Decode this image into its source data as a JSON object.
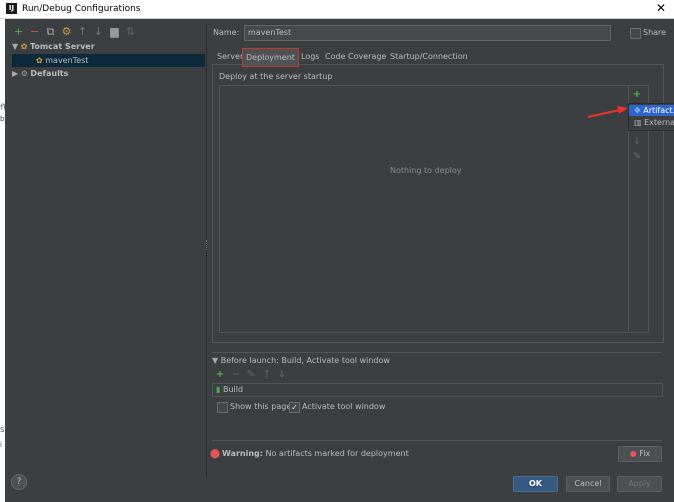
{
  "window": {
    "title": "Run/Debug Configurations",
    "app_icon_text": "IJ",
    "close_glyph": "✕"
  },
  "left_edge_chars": [
    "作",
    "b",
    "S",
    "i"
  ],
  "left_toolbar": [
    {
      "name": "add-icon",
      "glyph": "+",
      "color": "#4caf50"
    },
    {
      "name": "remove-icon",
      "glyph": "−",
      "color": "#e05050"
    },
    {
      "name": "copy-icon",
      "glyph": "⧉",
      "color": "#aaaaaa"
    },
    {
      "name": "wrench-icon",
      "glyph": "⚙",
      "color": "#cc9944"
    },
    {
      "name": "move-up-icon",
      "glyph": "↑",
      "color": "#777777"
    },
    {
      "name": "move-down-icon",
      "glyph": "↓",
      "color": "#777777"
    },
    {
      "name": "folder-icon",
      "glyph": "▆",
      "color": "#999999"
    },
    {
      "name": "sort-icon",
      "glyph": "⇅",
      "color": "#666666"
    }
  ],
  "tree": {
    "tomcat_label": "Tomcat Server",
    "maven_label": "mavenTest",
    "defaults_label": "Defaults"
  },
  "name_field": {
    "label": "Name:",
    "value": "mavenTest"
  },
  "share": {
    "label": "Share",
    "checked": false
  },
  "tabs": [
    {
      "label": "Server",
      "active": false
    },
    {
      "label": "Deployment",
      "active": true
    },
    {
      "label": "Logs",
      "active": false
    },
    {
      "label": "Code Coverage",
      "active": false
    },
    {
      "label": "Startup/Connection",
      "active": false
    }
  ],
  "deploy": {
    "section_label": "Deploy at the server startup",
    "empty_text": "Nothing to deploy"
  },
  "popup": {
    "items": [
      "Artifact...",
      "External"
    ]
  },
  "before_launch": {
    "header": "Before launch: Build, Activate tool window",
    "task": "Build",
    "show_page_label": "Show this page",
    "show_page_checked": false,
    "activate_label": "Activate tool window",
    "activate_checked": true
  },
  "warning": {
    "bold": "Warning:",
    "text": " No artifacts marked for deployment",
    "fix_label": "Fix"
  },
  "buttons": {
    "ok": "OK",
    "cancel": "Cancel",
    "apply": "Apply",
    "help": "?"
  },
  "colors": {
    "accent_selected": "#0d293e",
    "popup_selected": "#2f65ca",
    "arrow": "#e8342b"
  }
}
